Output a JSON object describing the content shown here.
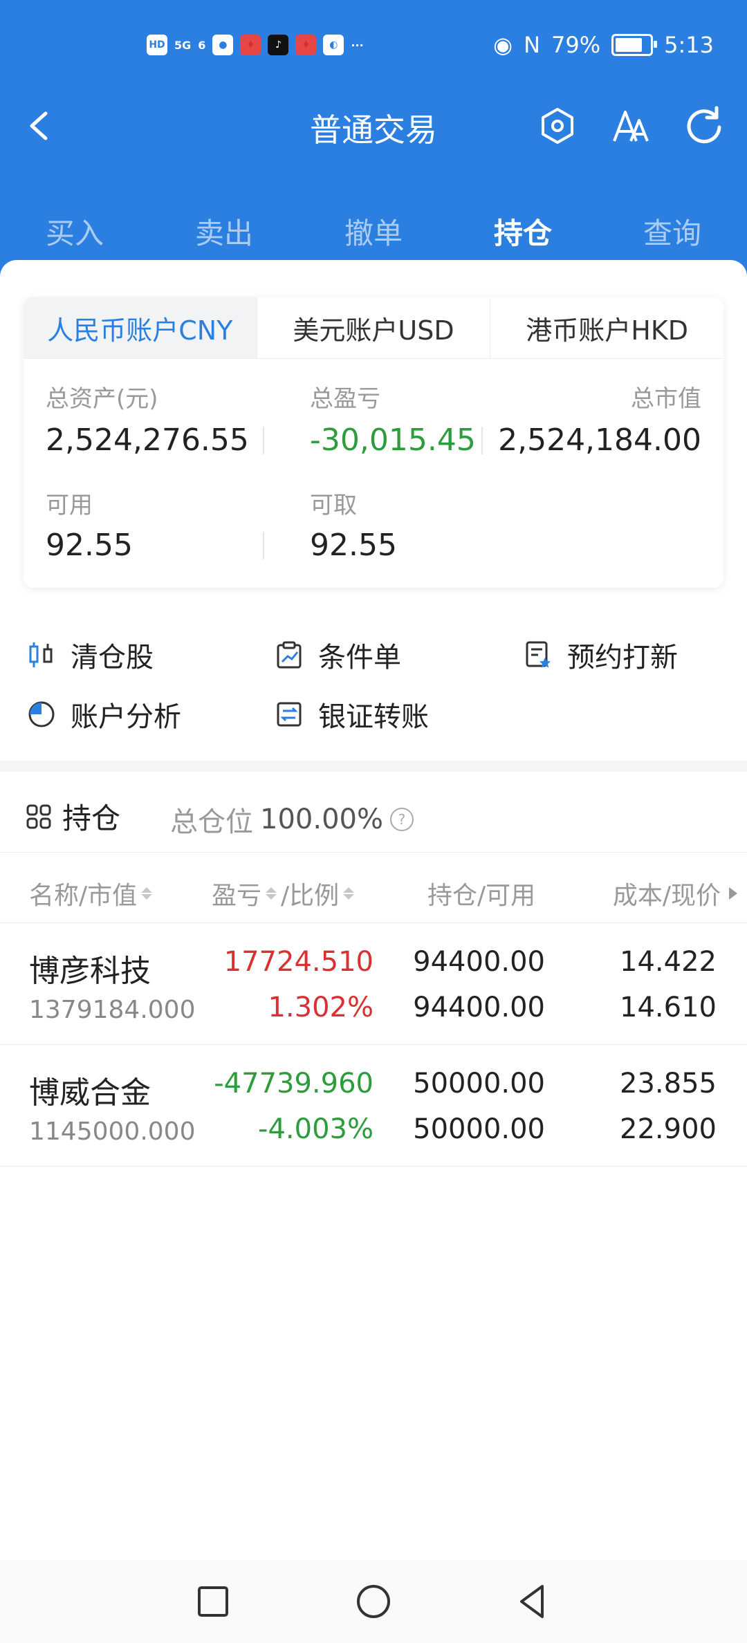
{
  "status_bar": {
    "left_labels": [
      "HD",
      "5G",
      "6"
    ],
    "battery": "79%",
    "time": "5:13"
  },
  "nav": {
    "title": "普通交易"
  },
  "tabs": [
    "买入",
    "卖出",
    "撤单",
    "持仓",
    "查询"
  ],
  "active_tab": "持仓",
  "account": {
    "tabs": [
      "人民币账户CNY",
      "美元账户USD",
      "港币账户HKD"
    ],
    "active_tab": "人民币账户CNY",
    "stats": {
      "total_assets_label": "总资产(元)",
      "total_assets": "2,524,276.55",
      "total_pl_label": "总盈亏",
      "total_pl": "-30,015.45",
      "market_value_label": "总市值",
      "market_value": "2,524,184.00",
      "available_label": "可用",
      "available": "92.55",
      "withdrawable_label": "可取",
      "withdrawable": "92.55"
    }
  },
  "quick_actions": [
    "清仓股",
    "条件单",
    "预约打新",
    "账户分析",
    "银证转账"
  ],
  "holdings": {
    "title": "持仓",
    "position_label": "总仓位",
    "position_value": "100.00%",
    "columns": [
      "名称/市值",
      "盈亏",
      "/比例",
      "持仓/可用",
      "成本/现价"
    ],
    "rows": [
      {
        "name": "博彦科技",
        "market_value": "1379184.000",
        "pl": "17724.510",
        "ratio": "1.302%",
        "position": "94400.00",
        "available": "94400.00",
        "cost": "14.422",
        "price": "14.610",
        "trend": "up"
      },
      {
        "name": "博威合金",
        "market_value": "1145000.000",
        "pl": "-47739.960",
        "ratio": "-4.003%",
        "position": "50000.00",
        "available": "50000.00",
        "cost": "23.855",
        "price": "22.900",
        "trend": "down"
      }
    ]
  },
  "colors": {
    "brand_blue": "#2b7fe0",
    "up_red": "#d93131",
    "down_green": "#2c9d3a"
  },
  "icons": {
    "back": "chevron-left-icon",
    "settings": "hexagon-settings-icon",
    "font": "font-size-icon",
    "refresh": "refresh-icon"
  }
}
